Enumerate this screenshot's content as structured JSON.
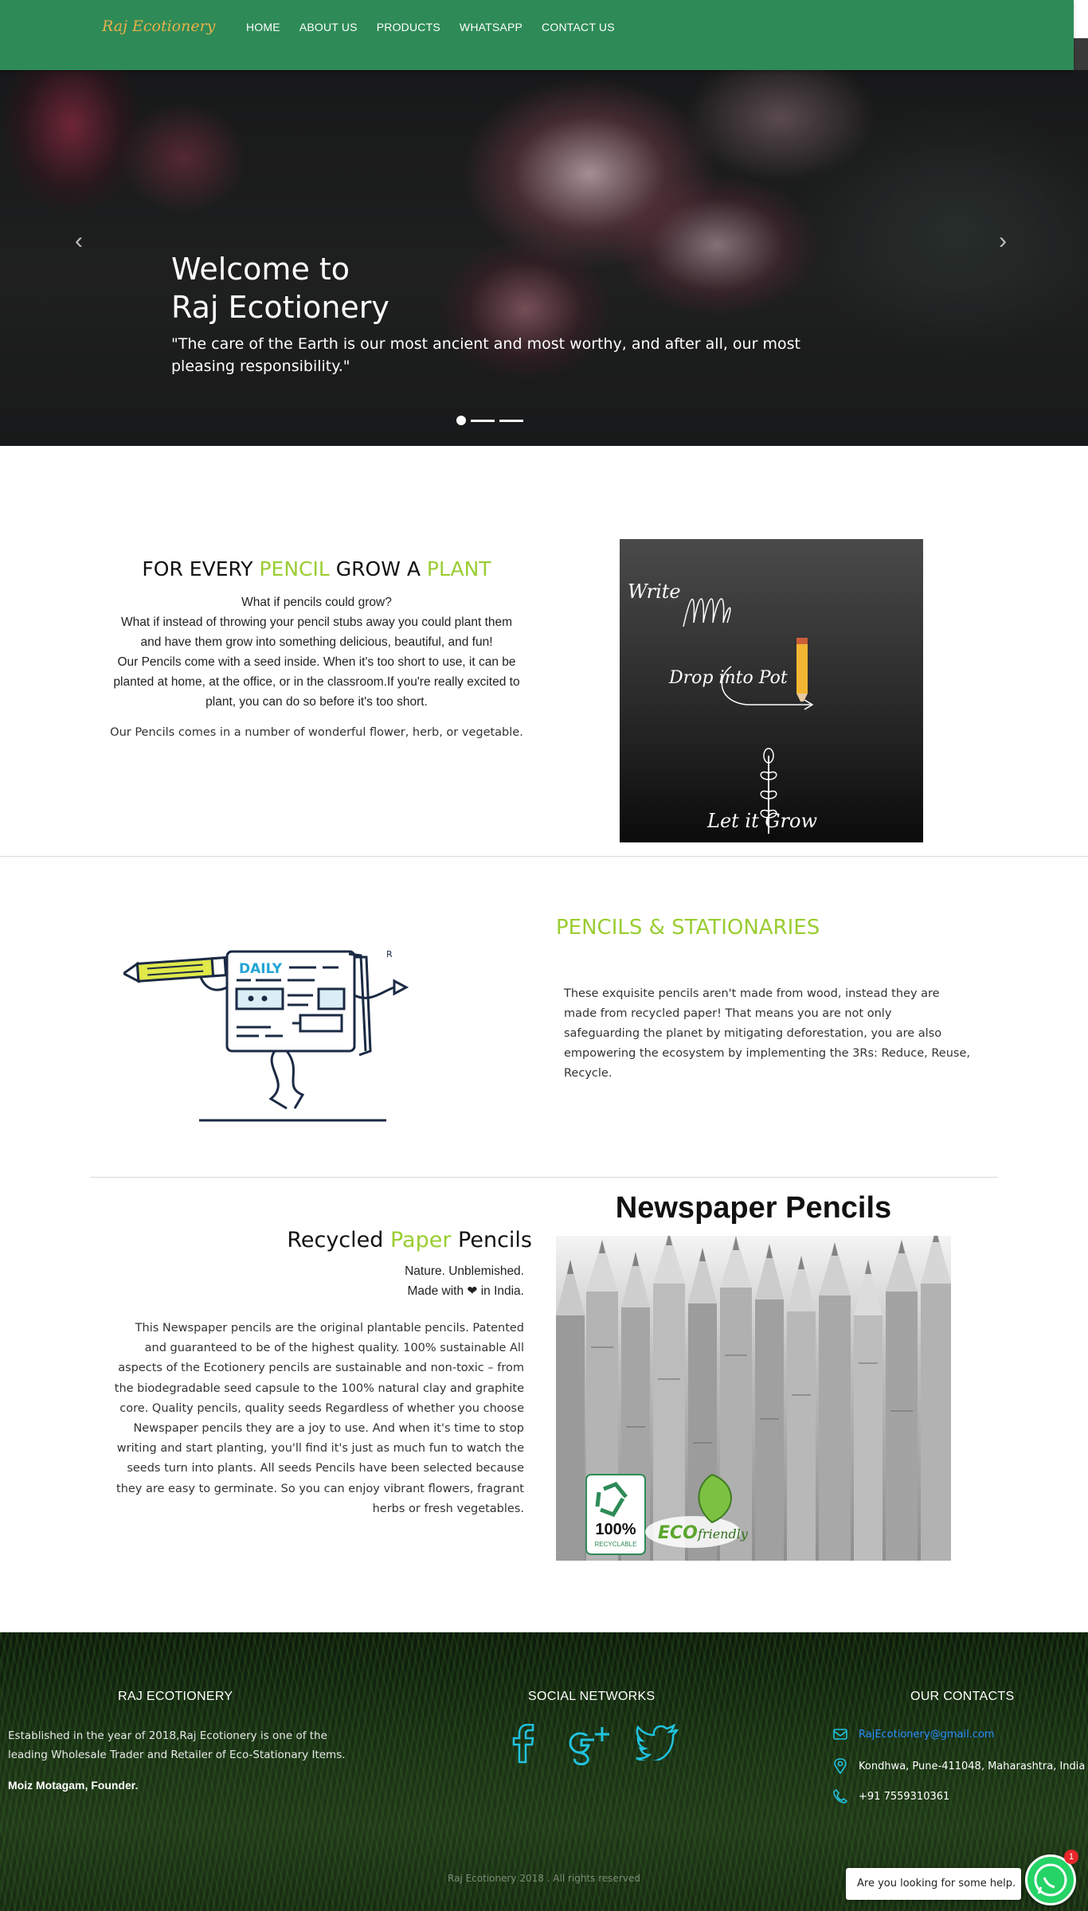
{
  "nav": {
    "brand": "Raj Ecotionery",
    "links": [
      "HOME",
      "ABOUT US",
      "PRODUCTS",
      "WHATSAPP",
      "CONTACT US"
    ]
  },
  "hero": {
    "title_line1": "Welcome to",
    "title_line2": "Raj Ecotionery",
    "quote": "\"The care of the Earth is our most ancient and most worthy, and after all, our most pleasing responsibility.\"",
    "prev_icon": "‹",
    "next_icon": "›",
    "slides": 3,
    "active_slide": 1
  },
  "section1": {
    "heading_part1": "FOR EVERY ",
    "heading_part2": "PENCIL",
    "heading_part3": " GROW A ",
    "heading_part4": "PLANT",
    "lines": [
      "What if pencils could grow?",
      "What if instead of throwing your pencil stubs away you could plant them and have them grow into something delicious, beautiful, and fun!",
      "Our Pencils come with a seed inside. When it's too short to use, it can be planted at home, at the office, or in the classroom.If you're really excited to plant, you can do so before it's too short."
    ],
    "note": "Our Pencils comes in a number of wonderful flower, herb, or vegetable.",
    "board": {
      "write": "Write",
      "drop": "Drop into Pot",
      "grow": "Let it Grow"
    }
  },
  "section2": {
    "heading": "PENCILS & STATIONARIES",
    "body": "These exquisite pencils aren't made from wood, instead they are made from recycled paper! That means you are not only safeguarding the planet by mitigating deforestation, you are also empowering the ecosystem by implementing the 3Rs: Reduce, Reuse, Recycle.",
    "illustration_label": "DAILY",
    "illustration_mark": "R"
  },
  "section3": {
    "heading_part1": "Recycled ",
    "heading_part2": "Paper",
    "heading_part3": " Pencils",
    "tag1": "Nature. Unblemished.",
    "tag2_pre": "Made with ",
    "tag2_heart": "❤",
    "tag2_post": " in India.",
    "body": "This Newspaper pencils are the original plantable pencils. Patented and guaranteed to be of the highest quality. 100% sustainable All aspects of the Ecotionery pencils are sustainable and non-toxic – from the biodegradable seed capsule to the 100% natural clay and graphite core. Quality pencils, quality seeds Regardless of whether you choose Newspaper pencils they are a joy to use. And when it's time to stop writing and start planting, you'll find it's just as much fun to watch the seeds turn into plants. All seeds Pencils have been selected because they are easy to germinate. So you can enjoy vibrant flowers, fragrant herbs or fresh vegetables.",
    "image_title": "Newspaper Pencils",
    "badge_100": "100%",
    "badge_recyclable": "RECYCLABLE",
    "badge_eco": "ECO",
    "badge_friendly": "friendly"
  },
  "footer": {
    "about_heading": "RAJ ECOTIONERY",
    "about_text": "Established in the year of 2018,Raj Ecotionery is one of the leading Wholesale Trader and Retailer of Eco-Stationary Items.",
    "founder": "Moiz Motagam, Founder.",
    "social_heading": "SOCIAL NETWORKS",
    "contacts_heading": "OUR CONTACTS",
    "email": "RajEcotionery@gmail.com",
    "address": "Kondhwa, Pune-411048, Maharashtra, India",
    "phone": "+91 7559310361",
    "copyright": "Raj Ecotionery 2018 . All rights reserved",
    "chat_prompt": "Are you looking for some help.",
    "chat_badge": "1"
  },
  "colors": {
    "nav": "#2e8b57",
    "accent": "#9acd32",
    "social": "#21c4e0",
    "brand": "#e8b04a"
  }
}
